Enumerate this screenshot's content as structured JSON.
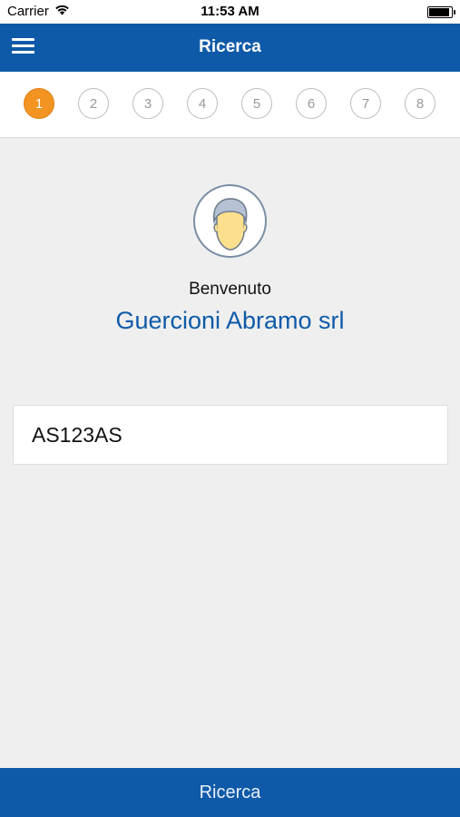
{
  "status_bar": {
    "carrier": "Carrier",
    "time": "11:53 AM",
    "battery_level": 1.0
  },
  "header": {
    "title": "Ricerca"
  },
  "stepper": {
    "steps": [
      "1",
      "2",
      "3",
      "4",
      "5",
      "6",
      "7",
      "8"
    ],
    "active": "1"
  },
  "welcome": {
    "greeting": "Benvenuto",
    "company_name": "Guercioni Abramo srl"
  },
  "search": {
    "plate_value": "AS123AS"
  },
  "footer": {
    "button_label": "Ricerca"
  },
  "colors": {
    "primary": "#0f5aa8",
    "accent": "#f29322",
    "background": "#efefef"
  },
  "icons": {
    "menu": "hamburger-icon",
    "wifi": "wifi-icon",
    "battery": "battery-icon",
    "avatar": "user-avatar-icon"
  }
}
